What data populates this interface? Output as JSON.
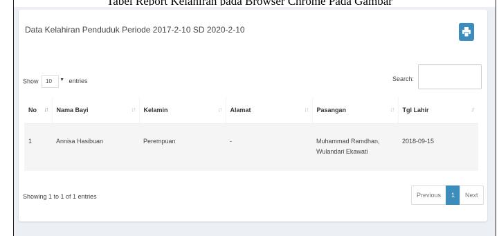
{
  "caption_cut": "Tabel Report Kelahiran pada Browser Chrome Pada Gambar",
  "panel": {
    "title": "Data Kelahiran Penduduk Periode 2017-2-10 SD 2020-2-10",
    "print_icon": "print-icon"
  },
  "length": {
    "prefix": "Show",
    "value": "10",
    "suffix": "entries"
  },
  "search": {
    "label": "Search:",
    "value": ""
  },
  "table": {
    "headers": [
      "No",
      "Nama Bayi",
      "Kelamin",
      "Alamat",
      "Pasangan",
      "Tgl Lahir"
    ],
    "rows": [
      {
        "no": "1",
        "nama_bayi": "Annisa Hasibuan",
        "kelamin": "Perempuan",
        "alamat": "-",
        "pasangan_line1": "Muhammad Ramdhan,",
        "pasangan_line2": "Wulandari Ekawati",
        "tgl_lahir": "2018-09-15"
      }
    ]
  },
  "info": "Showing 1 to 1 of 1 entries",
  "pagination": {
    "previous": "Previous",
    "current": "1",
    "next": "Next"
  },
  "colors": {
    "accent": "#3c8dbc",
    "content_bg": "#eceff3"
  }
}
